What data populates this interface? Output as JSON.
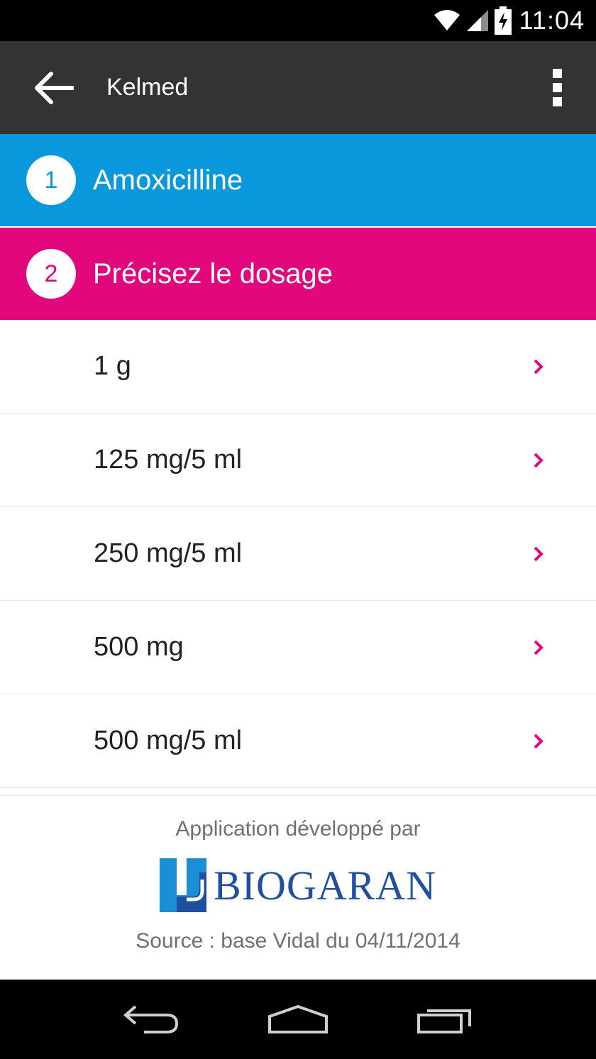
{
  "status_bar": {
    "time": "11:04",
    "icons": [
      "wifi-icon",
      "signal-icon",
      "battery-charging-icon"
    ]
  },
  "app_bar": {
    "title": "Kelmed",
    "back_icon": "arrow-back-icon",
    "menu_icon": "overflow-menu-icon"
  },
  "steps": [
    {
      "number": "1",
      "label": "Amoxicilline",
      "color": "#0a98dc"
    },
    {
      "number": "2",
      "label": "Précisez le dosage",
      "color": "#e3077d"
    }
  ],
  "dosages": [
    {
      "label": "1 g"
    },
    {
      "label": "125 mg/5 ml"
    },
    {
      "label": "250 mg/5 ml"
    },
    {
      "label": "500 mg"
    },
    {
      "label": "500 mg/5 ml"
    }
  ],
  "chevron_color": "#e3077d",
  "footer": {
    "developed_by": "Application développé par",
    "logo_text": "BIOGARAN",
    "source": "Source : base Vidal du 04/11/2014"
  },
  "nav_bar": {
    "icons": [
      "back-nav-icon",
      "home-nav-icon",
      "recents-nav-icon"
    ]
  }
}
